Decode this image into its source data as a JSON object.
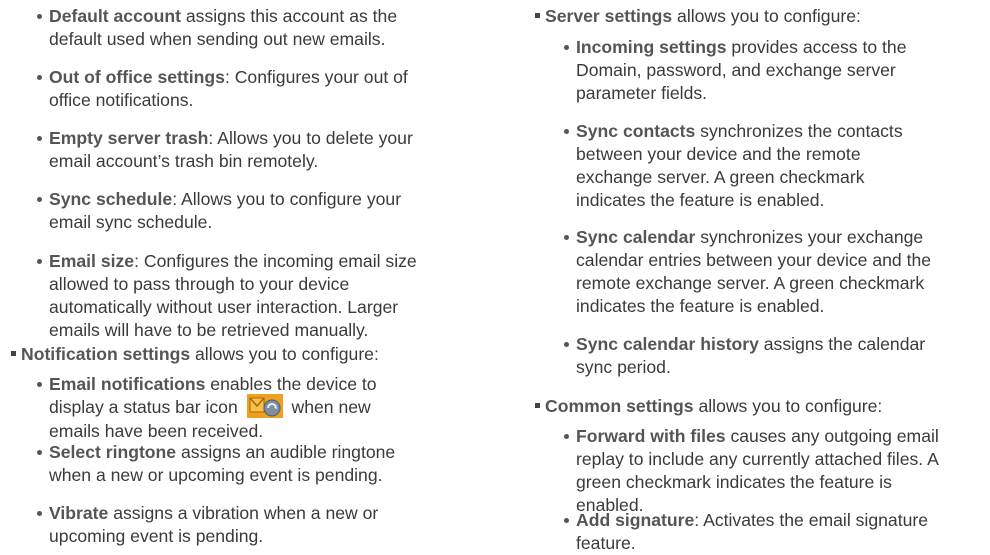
{
  "left": {
    "items": [
      {
        "term": "Default account",
        "text": " assigns this account as the",
        "text2": "default used when sending out new emails."
      },
      {
        "term": "Out of office settings",
        "text": ": Configures your out of",
        "text2": "office notifications."
      },
      {
        "term": "Empty server trash",
        "text": ": Allows you to delete your",
        "text2": "email account’s trash bin remotely."
      },
      {
        "term": "Sync schedule",
        "text": ": Allows you to configure your",
        "text2": "email sync schedule."
      },
      {
        "term": "Email size",
        "text": ": Configures the incoming email size",
        "text2": "allowed to pass through to your device",
        "text3": "automatically without user interaction. Larger",
        "text4": "emails will have to be retrieved manually."
      }
    ],
    "section": {
      "term": "Notification settings",
      "text": " allows you to configure:"
    },
    "sub": [
      {
        "term": "Email notifications",
        "text": " enables the device to",
        "text2a": "display a status bar icon",
        "text2b": "when new",
        "text3": "emails have been received."
      },
      {
        "term": "Select ringtone",
        "text": " assigns an audible ringtone",
        "text2": "when a new or upcoming event is pending."
      },
      {
        "term": "Vibrate",
        "text": " assigns a vibration when a new or",
        "text2": "upcoming event is pending."
      }
    ]
  },
  "right": {
    "section1": {
      "term": "Server settings",
      "text": " allows you to configure:"
    },
    "sub1": [
      {
        "term": "Incoming settings",
        "text": " provides access to the",
        "text2": "Domain, password, and exchange server",
        "text3": "parameter fields."
      },
      {
        "term": "Sync contacts",
        "text": " synchronizes the contacts",
        "text2": "between your device and the remote",
        "text3": "exchange server. A green checkmark",
        "text4": "indicates the feature is enabled."
      },
      {
        "term": "Sync calendar",
        "text": " synchronizes your exchange",
        "text2": "calendar entries between your device and the",
        "text3": "remote exchange server. A green checkmark",
        "text4": "indicates the feature is enabled."
      },
      {
        "term": "Sync calendar history",
        "text": " assigns the calendar",
        "text2": "sync period."
      }
    ],
    "section2": {
      "term": "Common settings",
      "text": " allows you to configure:"
    },
    "sub2": [
      {
        "term": "Forward with files",
        "text": " causes any outgoing email",
        "text2": "replay to include any currently attached files. A",
        "text3": "green checkmark indicates the feature is",
        "text4": "enabled."
      },
      {
        "term": "Add signature",
        "text": ": Activates the email signature",
        "text2": "feature."
      }
    ]
  },
  "icon": {
    "name": "email-notification-icon",
    "bg": "#f0a020"
  }
}
